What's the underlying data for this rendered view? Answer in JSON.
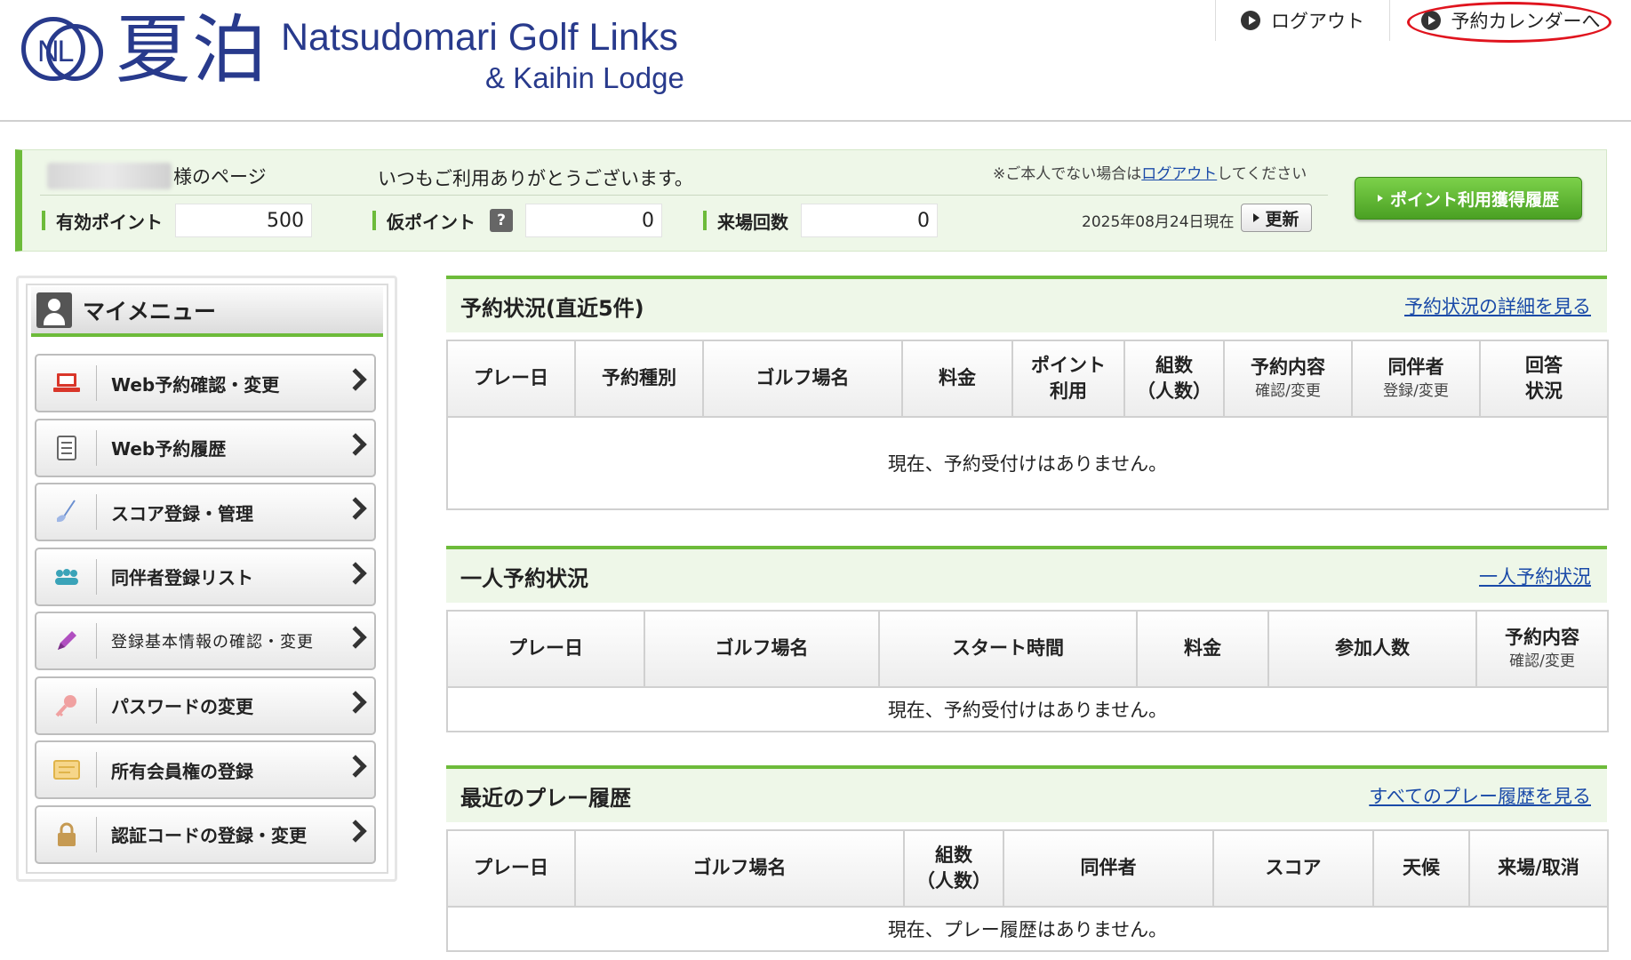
{
  "header": {
    "logo_mark": "NL",
    "logo_kanji": "夏泊",
    "logo_en_line1": "Natsudomari Golf Links",
    "logo_en_line2": "& Kaihin Lodge",
    "nav": {
      "logout": "ログアウト",
      "calendar": "予約カレンダーへ"
    }
  },
  "member": {
    "name_suffix": "様のページ",
    "greeting": "いつもご利用ありがとうございます。",
    "notice_prefix": "※ご本人でない場合は",
    "notice_link": "ログアウト",
    "notice_suffix": "してください",
    "valid_points_label": "有効ポイント",
    "valid_points": "500",
    "temp_points_label": "仮ポイント",
    "temp_points": "0",
    "visits_label": "来場回数",
    "visits": "0",
    "as_of": "2025年08月24日現在",
    "update_button": "更新",
    "points_history_button": "ポイント利用獲得履歴"
  },
  "sidebar": {
    "title": "マイメニュー",
    "items": [
      {
        "label": "Web予約確認・変更",
        "icon": "laptop-icon"
      },
      {
        "label": "Web予約履歴",
        "icon": "document-icon"
      },
      {
        "label": "スコア登録・管理",
        "icon": "golf-club-icon"
      },
      {
        "label": "同伴者登録リスト",
        "icon": "people-icon"
      },
      {
        "label": "登録基本情報の確認・変更",
        "icon": "pencil-icon"
      },
      {
        "label": "パスワードの変更",
        "icon": "key-icon"
      },
      {
        "label": "所有会員権の登録",
        "icon": "card-icon"
      },
      {
        "label": "認証コードの登録・変更",
        "icon": "lock-icon"
      }
    ]
  },
  "reservations": {
    "title": "予約状況(直近5件)",
    "link": "予約状況の詳細を見る",
    "columns": [
      "プレー日",
      "予約種別",
      "ゴルフ場名",
      "料金",
      "ポイント\n利用",
      "組数\n（人数）",
      "予約内容",
      "同伴者",
      "回答\n状況"
    ],
    "column_subs": {
      "6": "確認/変更",
      "7": "登録/変更"
    },
    "empty": "現在、予約受付けはありません。"
  },
  "solo": {
    "title": "一人予約状況",
    "link": "一人予約状況",
    "columns": [
      "プレー日",
      "ゴルフ場名",
      "スタート時間",
      "料金",
      "参加人数",
      "予約内容"
    ],
    "column_subs": {
      "5": "確認/変更"
    },
    "empty": "現在、予約受付けはありません。"
  },
  "history": {
    "title": "最近のプレー履歴",
    "link": "すべてのプレー履歴を見る",
    "columns": [
      "プレー日",
      "ゴルフ場名",
      "組数\n（人数）",
      "同伴者",
      "スコア",
      "天候",
      "来場/取消"
    ],
    "empty": "現在、プレー履歴はありません。"
  }
}
